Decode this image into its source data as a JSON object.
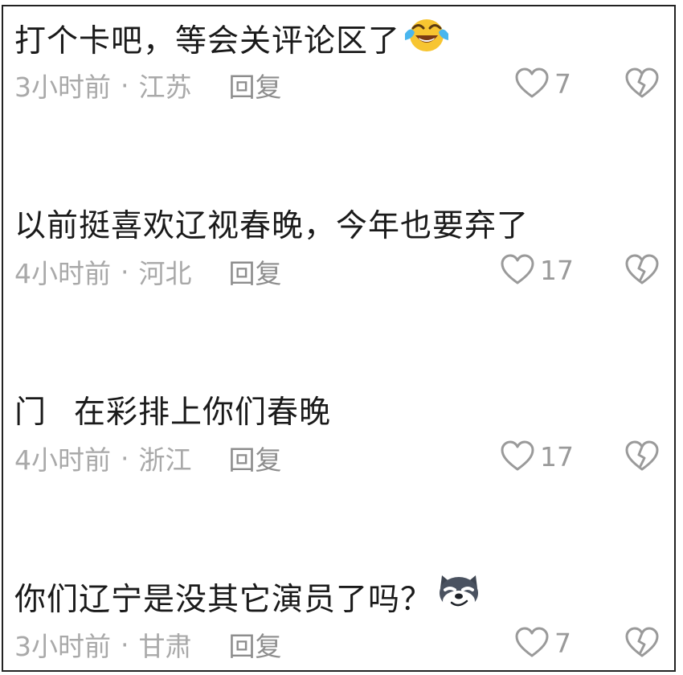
{
  "comments": [
    {
      "text": "打个卡吧，等会关评论区了",
      "time": "3小时前",
      "location": "江苏",
      "reply": "回复",
      "likes": "7",
      "emoji": "crying-laughing-emoji"
    },
    {
      "text": "以前挺喜欢辽视春晚，今年也要弃了",
      "time": "4小时前",
      "location": "河北",
      "reply": "回复",
      "likes": "17"
    },
    {
      "text_part1": "门",
      "text_part2": "在彩排上你们春晚",
      "time": "4小时前",
      "location": "浙江",
      "reply": "回复",
      "likes": "17"
    },
    {
      "text": "你们辽宁是没其它演员了吗？",
      "time": "3小时前",
      "location": "甘肃",
      "reply": "回复",
      "likes": "7",
      "emoji": "smirking-wolf-emoji"
    }
  ],
  "separator": "·",
  "colors": {
    "text": "#1a1a1a",
    "meta": "#a9a9a9",
    "icon": "#9a9a9a",
    "border": "#222222"
  }
}
